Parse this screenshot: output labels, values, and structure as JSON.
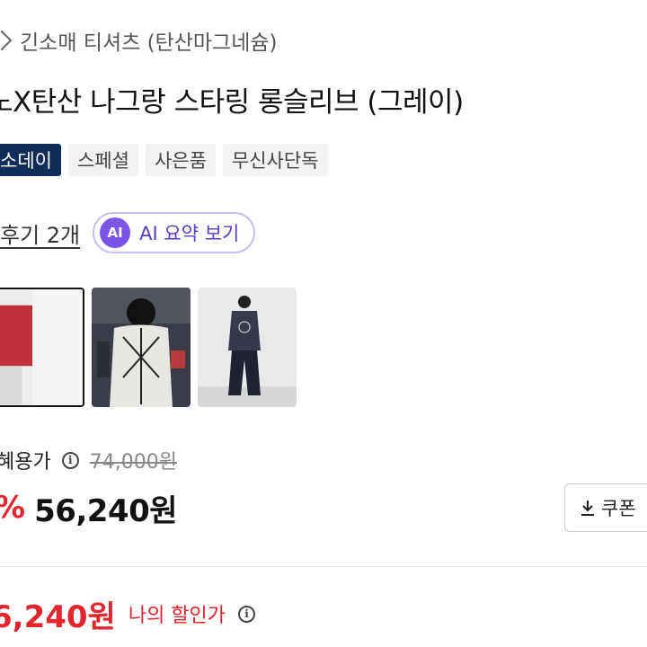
{
  "breadcrumb": {
    "text": "긴소매 티셔츠 (탄산마그네슘)"
  },
  "product": {
    "title": "노X탄산 나그랑 스타링 롱슬리브 (그레이)"
  },
  "badges": [
    {
      "label": "소데이"
    },
    {
      "label": "스페셜"
    },
    {
      "label": "사은품"
    },
    {
      "label": "무신사단독"
    }
  ],
  "reviews": {
    "link_label": "후기 2개",
    "ai_badge": "AI",
    "ai_label": "AI 요약 보기"
  },
  "pricing": {
    "label": "혜용가",
    "info_glyph": "i",
    "original_price": "74,000원",
    "discount": "%",
    "sale_price": "56,240원",
    "coupon_label": "쿠폰"
  },
  "my_discount": {
    "price": "6,240원",
    "label": "나의 할인가",
    "info_glyph": "i"
  },
  "colors": {
    "accent_red": "#e3262d",
    "badge_navy": "#0f2d59",
    "ai_purple": "#7b55e6"
  }
}
